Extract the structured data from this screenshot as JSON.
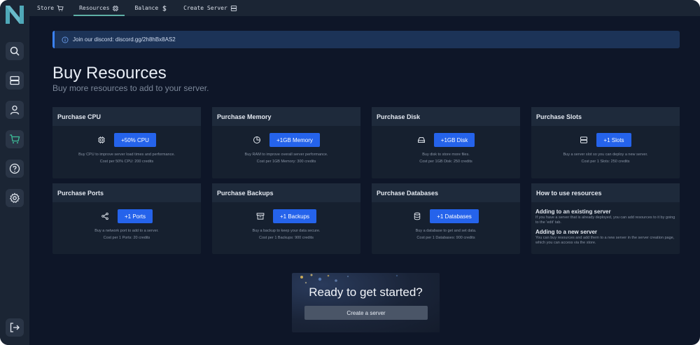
{
  "nav": {
    "items": [
      {
        "label": "Store",
        "icon": "cart-icon"
      },
      {
        "label": "Resources",
        "icon": "cpu-icon"
      },
      {
        "label": "Balance",
        "icon": "dollar-icon"
      },
      {
        "label": "Create Server",
        "icon": "server-icon"
      }
    ]
  },
  "sidebar": {
    "icons": [
      "search-icon",
      "server-icon",
      "user-icon",
      "cart-icon",
      "help-icon",
      "gear-icon",
      "logout-icon"
    ]
  },
  "banner": {
    "text": "Join our discord: discord.gg/2h8hBx8AS2"
  },
  "page": {
    "title": "Buy Resources",
    "subtitle": "Buy more resources to add to your server."
  },
  "cards": {
    "cpu": {
      "title": "Purchase CPU",
      "button": "+50% CPU",
      "desc": "Buy CPU to improve server load times and performance.",
      "cost": "Cost per 50% CPU: 200 credits"
    },
    "memory": {
      "title": "Purchase Memory",
      "button": "+1GB Memory",
      "desc": "Buy RAM to improve overall server performance.",
      "cost": "Cost per 1GB Memory: 300 credits"
    },
    "disk": {
      "title": "Purchase Disk",
      "button": "+1GB Disk",
      "desc": "Buy disk to store more files.",
      "cost": "Cost per 1GB Disk: 250 credits"
    },
    "slots": {
      "title": "Purchase Slots",
      "button": "+1 Slots",
      "desc": "Buy a server slot so you can deploy a new server.",
      "cost": "Cost per 1 Slots: 250 credits"
    },
    "ports": {
      "title": "Purchase Ports",
      "button": "+1 Ports",
      "desc": "Buy a network port to add to a server.",
      "cost": "Cost per 1 Ports: 20 credits"
    },
    "backups": {
      "title": "Purchase Backups",
      "button": "+1 Backups",
      "desc": "Buy a backup to keep your data secure.",
      "cost": "Cost per 1 Backups: 900 credits"
    },
    "databases": {
      "title": "Purchase Databases",
      "button": "+1 Databases",
      "desc": "Buy a database to get and set data.",
      "cost": "Cost per 1 Databases: 900 credits"
    }
  },
  "howto": {
    "title": "How to use resources",
    "existing_title": "Adding to an existing server",
    "existing_text": "If you have a server that is already deployed, you can add resources to it by going to the 'edit' tab.",
    "new_title": "Adding to a new server",
    "new_text": "You can buy resources and add them to a new server in the server creation page, which you can access via the store."
  },
  "cta": {
    "title": "Ready to get started?",
    "button": "Create a server"
  },
  "colors": {
    "accent": "#2563eb",
    "active_tab": "#5fb0a6",
    "sidebar_active": "#3dbf9a",
    "logo": "#4fa8b8"
  }
}
